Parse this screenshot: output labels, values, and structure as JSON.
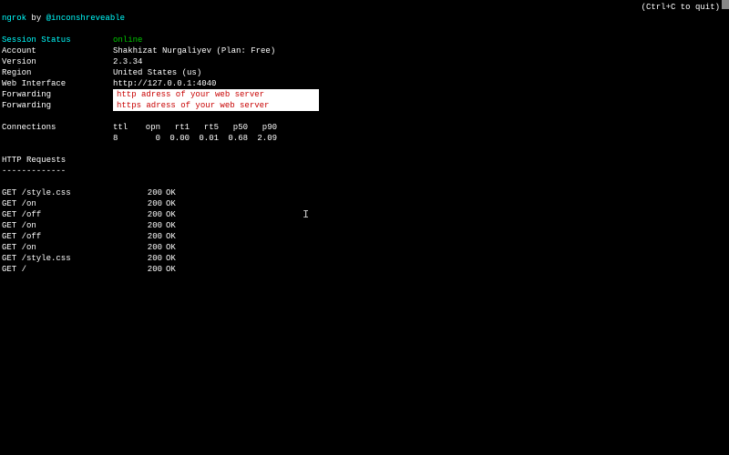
{
  "header": {
    "brand": "ngrok",
    "by": " by ",
    "author": "@inconshreveable",
    "quit_hint": "(Ctrl+C to quit)"
  },
  "session": {
    "status_label": "Session Status",
    "status_value": "online",
    "account_label": "Account",
    "account_value": "Shakhizat Nurgaliyev (Plan: Free)",
    "version_label": "Version",
    "version_value": "2.3.34",
    "region_label": "Region",
    "region_value": "United States (us)",
    "webiface_label": "Web Interface",
    "webiface_value": "http://127.0.0.1:4040",
    "fwd1_label": "Forwarding",
    "fwd1_value": "http adress of your web server",
    "fwd2_label": "Forwarding",
    "fwd2_value": "https adress of your web server"
  },
  "connections": {
    "label": "Connections",
    "headers": [
      "ttl",
      "opn",
      "rt1",
      "rt5",
      "p50",
      "p90"
    ],
    "values": [
      "8",
      "0",
      "0.00",
      "0.01",
      "0.68",
      "2.09"
    ]
  },
  "http": {
    "title": "HTTP Requests",
    "divider": "-------------",
    "rows": [
      {
        "path": "GET /style.css",
        "code": "200",
        "text": "OK"
      },
      {
        "path": "GET /on",
        "code": "200",
        "text": "OK"
      },
      {
        "path": "GET /off",
        "code": "200",
        "text": "OK"
      },
      {
        "path": "GET /on",
        "code": "200",
        "text": "OK"
      },
      {
        "path": "GET /off",
        "code": "200",
        "text": "OK"
      },
      {
        "path": "GET /on",
        "code": "200",
        "text": "OK"
      },
      {
        "path": "GET /style.css",
        "code": "200",
        "text": "OK"
      },
      {
        "path": "GET /",
        "code": "200",
        "text": "OK"
      }
    ]
  }
}
